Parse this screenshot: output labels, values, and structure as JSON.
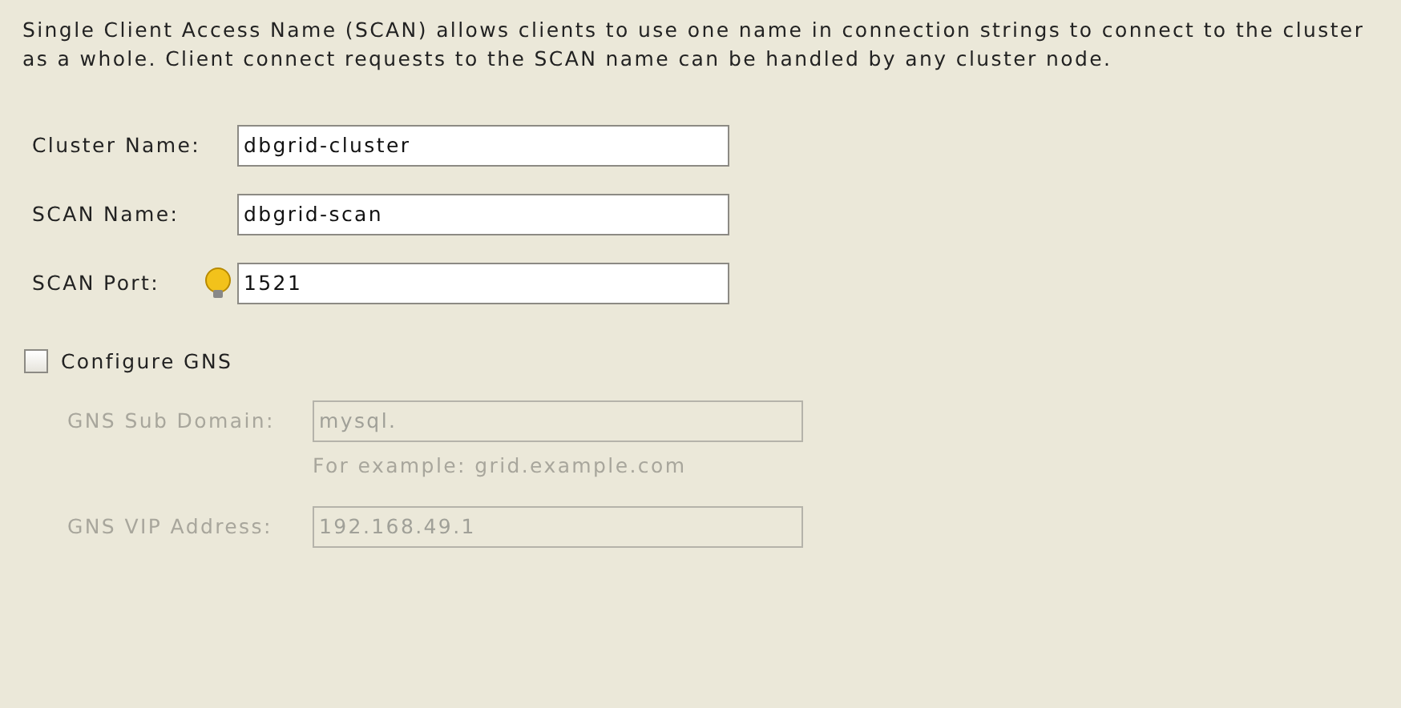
{
  "description": "Single Client Access Name (SCAN) allows clients to use one name in connection strings to connect to the cluster as a whole. Client connect requests to the SCAN name can be handled by any cluster node.",
  "fields": [
    {
      "label": "Cluster Name:",
      "value": "dbgrid-cluster",
      "hint_icon": false
    },
    {
      "label": "SCAN Name:",
      "value": "dbgrid-scan",
      "hint_icon": false
    },
    {
      "label": "SCAN Port:",
      "value": "1521",
      "hint_icon": true
    }
  ],
  "gns": {
    "label": "Configure GNS",
    "checked": false,
    "fields": [
      {
        "label": "GNS Sub Domain:",
        "value": "mysql.",
        "disabled": true,
        "example": "For example: grid.example.com"
      },
      {
        "label": "GNS VIP Address:",
        "value": "192.168.49.1",
        "disabled": true
      }
    ]
  }
}
